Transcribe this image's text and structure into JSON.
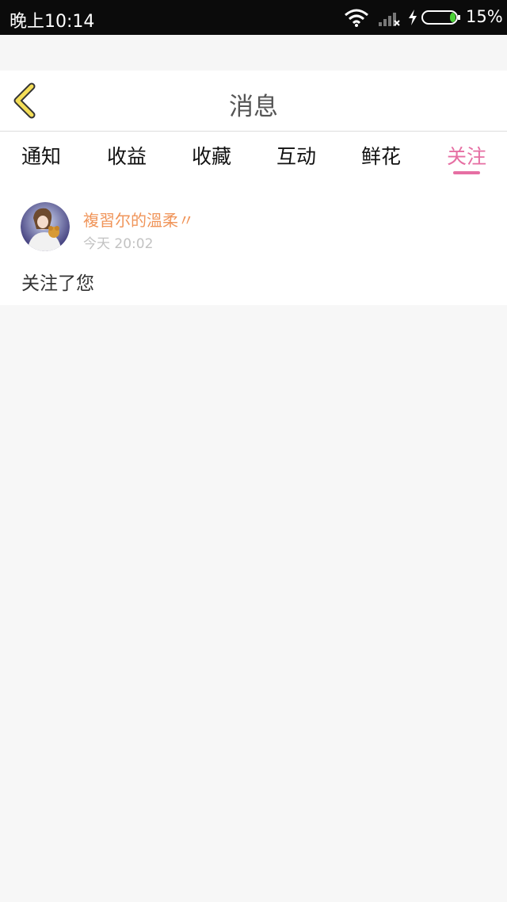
{
  "status_bar": {
    "time": "晚上10:14",
    "battery_percent": "15%",
    "battery_level": 0.15,
    "icons": [
      "wifi-icon",
      "signal-icon",
      "charging-icon",
      "battery-icon"
    ]
  },
  "header": {
    "title": "消息",
    "back_icon": "chevron-left-icon"
  },
  "tabs": [
    {
      "label": "通知",
      "active": false
    },
    {
      "label": "收益",
      "active": false
    },
    {
      "label": "收藏",
      "active": false
    },
    {
      "label": "互动",
      "active": false
    },
    {
      "label": "鲜花",
      "active": false
    },
    {
      "label": "关注",
      "active": true
    }
  ],
  "message": {
    "user_name": "複習尔的溫柔〃",
    "timestamp": "今天 20:02",
    "text": "关注了您"
  },
  "colors": {
    "accent_pink": "#e66fa3",
    "username_orange": "#f0955a",
    "back_arrow_yellow": "#f4de58",
    "battery_green": "#4cd137"
  }
}
